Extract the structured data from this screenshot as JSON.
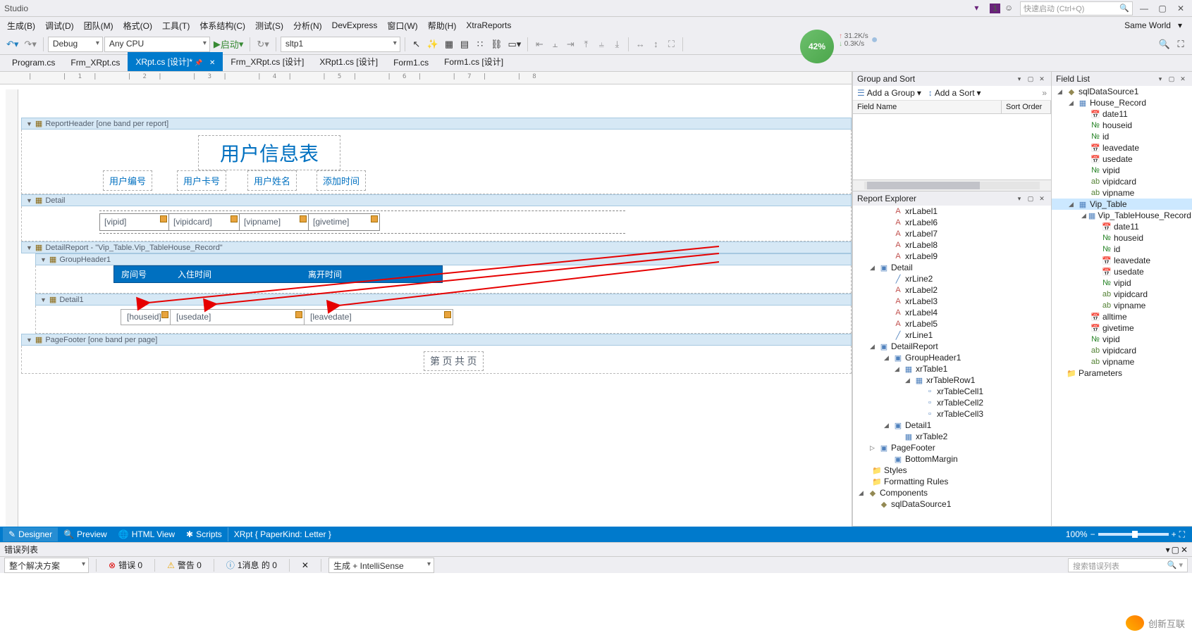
{
  "title": "Studio",
  "quicklaunch_placeholder": "快速启动 (Ctrl+Q)",
  "account_label": "Same World",
  "menus": [
    "生成(B)",
    "调试(D)",
    "团队(M)",
    "格式(O)",
    "工具(T)",
    "体系结构(C)",
    "测试(S)",
    "分析(N)",
    "DevExpress",
    "窗口(W)",
    "帮助(H)",
    "XtraReports"
  ],
  "toolbar": {
    "config": "Debug",
    "platform": "Any CPU",
    "start": "启动",
    "proc": "sltp1"
  },
  "tabs": [
    {
      "label": "Program.cs",
      "active": false
    },
    {
      "label": "Frm_XRpt.cs",
      "active": false
    },
    {
      "label": "XRpt.cs [设计]*",
      "active": true,
      "pinned": true
    },
    {
      "label": "Frm_XRpt.cs [设计]",
      "active": false
    },
    {
      "label": "XRpt1.cs [设计]",
      "active": false
    },
    {
      "label": "Form1.cs",
      "active": false
    },
    {
      "label": "Form1.cs [设计]",
      "active": false
    }
  ],
  "report": {
    "header_band": "ReportHeader [one band per report]",
    "title": "用户信息表",
    "cols": {
      "c1": "用户编号",
      "c2": "用户卡号",
      "c3": "用户姓名",
      "c4": "添加时间"
    },
    "detail_band": "Detail",
    "detail_cells": [
      "[vipid]",
      "[vipidcard]",
      "[vipname]",
      "[givetime]"
    ],
    "detailreport_band": "DetailReport - \"Vip_Table.Vip_TableHouse_Record\"",
    "groupheader_band": "GroupHeader1",
    "group_cells": {
      "g1": "房间号",
      "g2": "入住时间",
      "g3": "离开时间"
    },
    "detail1_band": "Detail1",
    "detail1_cells": [
      "[houseid]",
      "[usedate]",
      "[leavedate]"
    ],
    "pagefooter_band": "PageFooter [one band per page]",
    "footer_text": "第 页 共 页"
  },
  "group_sort": {
    "title": "Group and Sort",
    "add_group": "Add a Group",
    "add_sort": "Add a Sort",
    "col1": "Field Name",
    "col2": "Sort Order"
  },
  "report_explorer": {
    "title": "Report Explorer",
    "items": [
      {
        "pad": 40,
        "icon": "label",
        "label": "xrLabel1"
      },
      {
        "pad": 40,
        "icon": "label",
        "label": "xrLabel6"
      },
      {
        "pad": 40,
        "icon": "label",
        "label": "xrLabel7"
      },
      {
        "pad": 40,
        "icon": "label",
        "label": "xrLabel8"
      },
      {
        "pad": 40,
        "icon": "label",
        "label": "xrLabel9"
      },
      {
        "pad": 20,
        "toggle": "◢",
        "icon": "band",
        "label": "Detail"
      },
      {
        "pad": 40,
        "icon": "line",
        "label": "xrLine2"
      },
      {
        "pad": 40,
        "icon": "label",
        "label": "xrLabel2"
      },
      {
        "pad": 40,
        "icon": "label",
        "label": "xrLabel3"
      },
      {
        "pad": 40,
        "icon": "label",
        "label": "xrLabel4"
      },
      {
        "pad": 40,
        "icon": "label",
        "label": "xrLabel5"
      },
      {
        "pad": 40,
        "icon": "line",
        "label": "xrLine1"
      },
      {
        "pad": 20,
        "toggle": "◢",
        "icon": "band",
        "label": "DetailReport"
      },
      {
        "pad": 40,
        "toggle": "◢",
        "icon": "band",
        "label": "GroupHeader1"
      },
      {
        "pad": 55,
        "toggle": "◢",
        "icon": "table",
        "label": "xrTable1"
      },
      {
        "pad": 70,
        "toggle": "◢",
        "icon": "table",
        "label": "xrTableRow1"
      },
      {
        "pad": 85,
        "icon": "cell",
        "label": "xrTableCell1"
      },
      {
        "pad": 85,
        "icon": "cell",
        "label": "xrTableCell2"
      },
      {
        "pad": 85,
        "icon": "cell",
        "label": "xrTableCell3"
      },
      {
        "pad": 40,
        "toggle": "◢",
        "icon": "band",
        "label": "Detail1"
      },
      {
        "pad": 55,
        "icon": "table",
        "label": "xrTable2"
      },
      {
        "pad": 20,
        "toggle": "▷",
        "icon": "band",
        "label": "PageFooter"
      },
      {
        "pad": 40,
        "icon": "band",
        "label": "BottomMargin"
      },
      {
        "pad": 10,
        "icon": "folder",
        "label": "Styles"
      },
      {
        "pad": 10,
        "icon": "folder",
        "label": "Formatting Rules"
      },
      {
        "pad": 4,
        "toggle": "◢",
        "icon": "ds",
        "label": "Components"
      },
      {
        "pad": 20,
        "icon": "ds",
        "label": "sqlDataSource1"
      }
    ]
  },
  "field_list": {
    "title": "Field List",
    "items": [
      {
        "pad": 4,
        "toggle": "◢",
        "icon": "ds",
        "label": "sqlDataSource1"
      },
      {
        "pad": 20,
        "toggle": "◢",
        "icon": "table",
        "label": "House_Record"
      },
      {
        "pad": 38,
        "icon": "date",
        "label": "date11"
      },
      {
        "pad": 38,
        "icon": "num",
        "label": "houseid"
      },
      {
        "pad": 38,
        "icon": "num",
        "label": "id"
      },
      {
        "pad": 38,
        "icon": "date",
        "label": "leavedate"
      },
      {
        "pad": 38,
        "icon": "date",
        "label": "usedate"
      },
      {
        "pad": 38,
        "icon": "num",
        "label": "vipid"
      },
      {
        "pad": 38,
        "icon": "str",
        "label": "vipidcard"
      },
      {
        "pad": 38,
        "icon": "str",
        "label": "vipname"
      },
      {
        "pad": 20,
        "toggle": "◢",
        "icon": "table",
        "label": "Vip_Table",
        "selected": true
      },
      {
        "pad": 38,
        "toggle": "◢",
        "icon": "table",
        "label": "Vip_TableHouse_Record"
      },
      {
        "pad": 54,
        "icon": "date",
        "label": "date11"
      },
      {
        "pad": 54,
        "icon": "num",
        "label": "houseid"
      },
      {
        "pad": 54,
        "icon": "num",
        "label": "id"
      },
      {
        "pad": 54,
        "icon": "date",
        "label": "leavedate"
      },
      {
        "pad": 54,
        "icon": "date",
        "label": "usedate"
      },
      {
        "pad": 54,
        "icon": "num",
        "label": "vipid"
      },
      {
        "pad": 54,
        "icon": "str",
        "label": "vipidcard"
      },
      {
        "pad": 54,
        "icon": "str",
        "label": "vipname"
      },
      {
        "pad": 38,
        "icon": "date",
        "label": "alltime"
      },
      {
        "pad": 38,
        "icon": "date",
        "label": "givetime"
      },
      {
        "pad": 38,
        "icon": "num",
        "label": "vipid"
      },
      {
        "pad": 38,
        "icon": "str",
        "label": "vipidcard"
      },
      {
        "pad": 38,
        "icon": "str",
        "label": "vipname"
      },
      {
        "pad": 4,
        "icon": "folder",
        "label": "Parameters"
      }
    ]
  },
  "bottom": {
    "designer": "Designer",
    "preview": "Preview",
    "html": "HTML View",
    "scripts": "Scripts",
    "breadcrumb": "XRpt { PaperKind: Letter }",
    "zoom": "100%"
  },
  "error": {
    "title": "错误列表",
    "scope": "整个解决方案",
    "errors": "错误 0",
    "warnings": "警告 0",
    "messages": "1消息 的 0",
    "build": "生成 + IntelliSense",
    "search": "搜索错误列表"
  },
  "status": {
    "pct": "42%",
    "down": "31.2K/s",
    "up": "0.3K/s"
  },
  "watermark": "创新互联"
}
